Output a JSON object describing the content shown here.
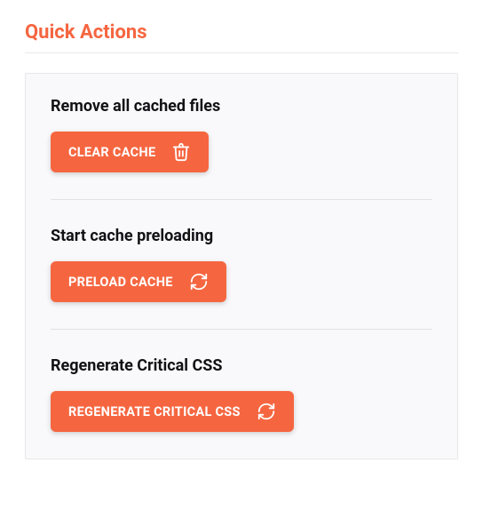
{
  "section_title": "Quick Actions",
  "colors": {
    "accent": "#f56640"
  },
  "actions": [
    {
      "heading": "Remove all cached files",
      "button_label": "Clear Cache",
      "icon": "trash-icon"
    },
    {
      "heading": "Start cache preloading",
      "button_label": "Preload Cache",
      "icon": "refresh-icon"
    },
    {
      "heading": "Regenerate Critical CSS",
      "button_label": "Regenerate Critical CSS",
      "icon": "refresh-icon"
    }
  ]
}
